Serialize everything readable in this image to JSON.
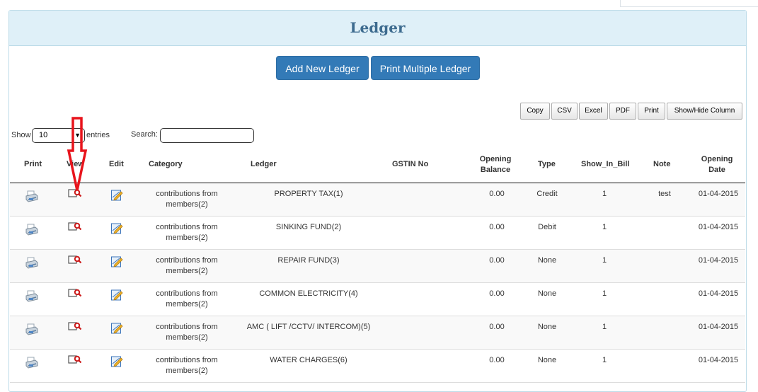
{
  "page": {
    "title": "Ledger"
  },
  "actions": {
    "add_new": "Add New Ledger",
    "print_multiple": "Print Multiple Ledger"
  },
  "export_buttons": {
    "copy": "Copy",
    "csv": "CSV",
    "excel": "Excel",
    "pdf": "PDF",
    "print": "Print",
    "show_hide": "Show/Hide Column"
  },
  "table_controls": {
    "show_label": "Show",
    "entries_value": "10",
    "entries_label": "entries",
    "search_label": "Search:",
    "search_value": ""
  },
  "columns": {
    "print": "Print",
    "view": "View",
    "edit": "Edit",
    "category": "Category",
    "ledger": "Ledger",
    "gstin": "GSTIN No",
    "opening_balance_1": "Opening",
    "opening_balance_2": "Balance",
    "type": "Type",
    "show_in_bill": "Show_In_Bill",
    "note": "Note",
    "opening_date_1": "Opening",
    "opening_date_2": "Date"
  },
  "icons": {
    "print": "printer-icon",
    "view": "magnify-view-icon",
    "edit": "edit-pencil-icon",
    "annotation": "red-down-arrow-icon"
  },
  "colors": {
    "header_bg": "#dff0f8",
    "primary": "#337ab7",
    "title": "#3d6b8f",
    "arrow": "#e8141c"
  },
  "rows": [
    {
      "category_1": "contributions from",
      "category_2": "members(2)",
      "ledger": "PROPERTY TAX(1)",
      "gstin": "",
      "opening_balance": "0.00",
      "type": "Credit",
      "show_in_bill": "1",
      "note": "test",
      "opening_date": "01-04-2015"
    },
    {
      "category_1": "contributions from",
      "category_2": "members(2)",
      "ledger": "SINKING FUND(2)",
      "gstin": "",
      "opening_balance": "0.00",
      "type": "Debit",
      "show_in_bill": "1",
      "note": "",
      "opening_date": "01-04-2015"
    },
    {
      "category_1": "contributions from",
      "category_2": "members(2)",
      "ledger": "REPAIR FUND(3)",
      "gstin": "",
      "opening_balance": "0.00",
      "type": "None",
      "show_in_bill": "1",
      "note": "",
      "opening_date": "01-04-2015"
    },
    {
      "category_1": "contributions from",
      "category_2": "members(2)",
      "ledger": "COMMON ELECTRICITY(4)",
      "gstin": "",
      "opening_balance": "0.00",
      "type": "None",
      "show_in_bill": "1",
      "note": "",
      "opening_date": "01-04-2015"
    },
    {
      "category_1": "contributions from",
      "category_2": "members(2)",
      "ledger": "AMC ( LIFT /CCTV/ INTERCOM)(5)",
      "gstin": "",
      "opening_balance": "0.00",
      "type": "None",
      "show_in_bill": "1",
      "note": "",
      "opening_date": "01-04-2015"
    },
    {
      "category_1": "contributions from",
      "category_2": "members(2)",
      "ledger": "WATER CHARGES(6)",
      "gstin": "",
      "opening_balance": "0.00",
      "type": "None",
      "show_in_bill": "1",
      "note": "",
      "opening_date": "01-04-2015"
    }
  ]
}
